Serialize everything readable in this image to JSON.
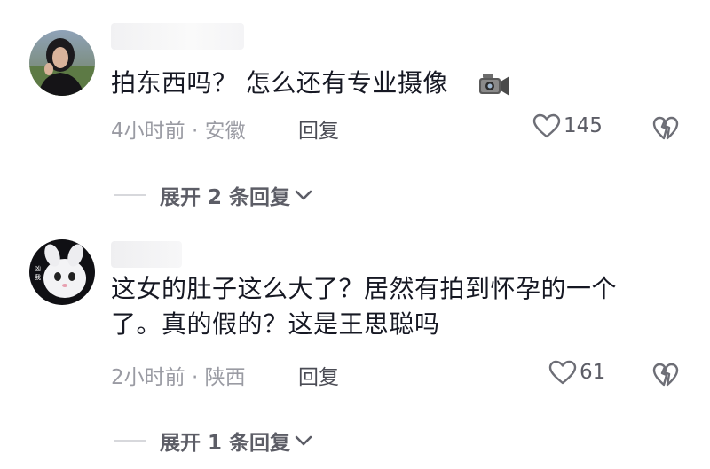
{
  "comments": [
    {
      "avatar": "avatar-woman-photo",
      "text_lines": [
        "拍东西吗？ 怎么还有专业摄像"
      ],
      "emoji": "video-camera-icon",
      "meta": "4小时前 · 安徽",
      "reply_label": "回复",
      "likes": "145",
      "expand_label": "展开 2 条回复"
    },
    {
      "avatar": "avatar-cartoon-bunny",
      "text_lines": [
        "这女的肚子这么大了？居然有拍到怀孕的一个",
        "了。真的假的？这是王思聪吗"
      ],
      "meta": "2小时前 · 陕西",
      "reply_label": "回复",
      "likes": "61",
      "expand_label": "展开 1 条回复"
    }
  ],
  "colors": {
    "text": "#161823",
    "secondary": "#9a9ba3",
    "action": "#5c5d66"
  }
}
